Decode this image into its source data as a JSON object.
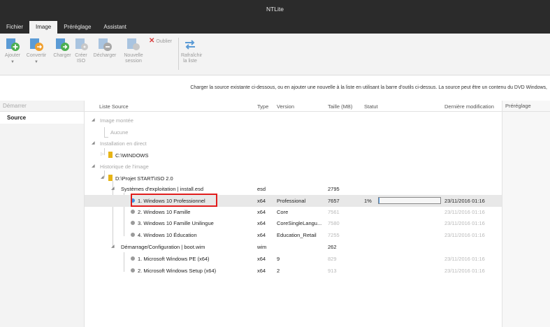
{
  "window": {
    "title": "NTLite"
  },
  "tabs": [
    {
      "label": "Fichier",
      "active": false
    },
    {
      "label": "Image",
      "active": true
    },
    {
      "label": "Préréglage",
      "active": false
    },
    {
      "label": "Assistant",
      "active": false
    }
  ],
  "ribbon": {
    "ajouter": "Ajouter",
    "convertir": "Convertir",
    "charger": "Charger",
    "creer_iso": "Créer ISO",
    "decharger": "Décharger",
    "nouvelle_session": "Nouvelle session",
    "oublier": "Oublier",
    "rafraichir": "Rafraîchir la liste"
  },
  "info_text": "Charger la source existante ci-dessous, ou en ajouter une nouvelle à la liste en utilisant la barre d'outils ci-dessus. La source peut être un contenu du DVD Windows,",
  "nav": {
    "heading": "Démarrer",
    "items": [
      "Source"
    ]
  },
  "columns": {
    "liste_source": "Liste Source",
    "type": "Type",
    "version": "Version",
    "taille": "Taille (MB)",
    "statut": "Statut",
    "modif": "Dernière modification"
  },
  "right_panel": {
    "heading": "Préréglage"
  },
  "colors": {
    "accent": "#3c91e6",
    "highlight": "#e11d1d",
    "folder": "#e7b416"
  },
  "tree": {
    "mounted": {
      "label": "Image montée",
      "empty": "Aucune"
    },
    "live": {
      "label": "Installation en direct",
      "path": "C:\\WINDOWS"
    },
    "history": {
      "label": "Historique de l'image",
      "path": "D:\\Projet START\\ISO 2.0",
      "os_group": {
        "label": "Systèmes d'exploitation | install.esd",
        "type": "esd",
        "size": "2795"
      },
      "os_images": [
        {
          "name": "1. Windows 10 Professionnel",
          "type": "x64",
          "version": "Professional",
          "size": "7657",
          "status": "1%",
          "progress": 0.01,
          "modified": "23/11/2016 01:16",
          "loaded": true
        },
        {
          "name": "2. Windows 10 Famille",
          "type": "x64",
          "version": "Core",
          "size": "7561",
          "status": "",
          "modified": "23/11/2016 01:16",
          "loaded": false
        },
        {
          "name": "3. Windows 10 Famille Unilingue",
          "type": "x64",
          "version": "CoreSingleLangu...",
          "size": "7580",
          "status": "",
          "modified": "23/11/2016 01:16",
          "loaded": false
        },
        {
          "name": "4. Windows 10 Éducation",
          "type": "x64",
          "version": "Education_Retail",
          "size": "7255",
          "status": "",
          "modified": "23/11/2016 01:16",
          "loaded": false
        }
      ],
      "boot_group": {
        "label": "Démarrage/Configuration | boot.wim",
        "type": "wim",
        "size": "262"
      },
      "boot_images": [
        {
          "name": "1. Microsoft Windows PE (x64)",
          "type": "x64",
          "version": "9",
          "size": "829",
          "modified": "23/11/2016 01:16"
        },
        {
          "name": "2. Microsoft Windows Setup (x64)",
          "type": "x64",
          "version": "2",
          "size": "913",
          "modified": "23/11/2016 01:16"
        }
      ]
    }
  }
}
